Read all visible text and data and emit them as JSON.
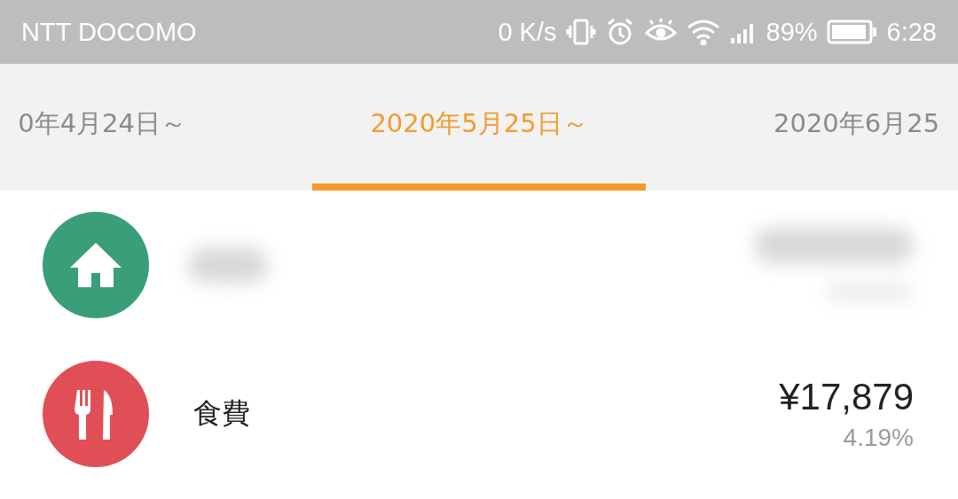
{
  "status_bar": {
    "carrier": "NTT DOCOMO",
    "speed": "0 K/s",
    "battery": "89%",
    "time": "6:28"
  },
  "tabs": [
    {
      "label": "0年4月24日～",
      "selected": false
    },
    {
      "label": "2020年5月25日～",
      "selected": true
    },
    {
      "label": "2020年6月25",
      "selected": false
    }
  ],
  "categories": [
    {
      "kind": "home",
      "color": "#3a9e78",
      "redacted": true
    },
    {
      "kind": "food",
      "color": "#e04f55",
      "redacted": false,
      "name": "食費",
      "amount": "¥17,879",
      "percent": "4.19%"
    }
  ]
}
